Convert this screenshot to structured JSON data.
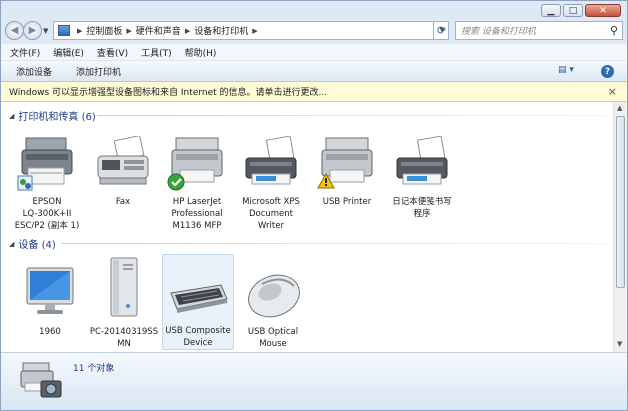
{
  "breadcrumb": [
    "控制面板",
    "硬件和声音",
    "设备和打印机"
  ],
  "search_placeholder": "搜索 设备和打印机",
  "menu": [
    "文件(F)",
    "编辑(E)",
    "查看(V)",
    "工具(T)",
    "帮助(H)"
  ],
  "commands": [
    "添加设备",
    "添加打印机"
  ],
  "infobar_text": "Windows 可以显示增强型设备图标和来自 Internet 的信息。请单击进行更改...",
  "groups": {
    "printers": {
      "title": "打印机和传真 (6)",
      "items": [
        {
          "label": "EPSON\nLQ-300K+II\nESC/P2 (副本 1)",
          "icon": "printer-icon",
          "badge": "shared-badge-icon"
        },
        {
          "label": "Fax",
          "icon": "fax-icon"
        },
        {
          "label": "HP LaserJet\nProfessional\nM1136 MFP",
          "icon": "printer-icon",
          "badge": "default-check-icon"
        },
        {
          "label": "Microsoft XPS\nDocument\nWriter",
          "icon": "printer-icon"
        },
        {
          "label": "USB Printer",
          "icon": "printer-icon",
          "badge": "warning-icon"
        },
        {
          "label": "日记本便笺书写\n程序",
          "icon": "printer-icon"
        }
      ]
    },
    "devices": {
      "title": "设备 (4)",
      "items": [
        {
          "label": "1960",
          "icon": "monitor-icon"
        },
        {
          "label": "PC-20140319SS\nMN",
          "icon": "computer-tower-icon"
        },
        {
          "label": "USB Composite\nDevice",
          "icon": "keyboard-icon",
          "selected": true
        },
        {
          "label": "USB Optical\nMouse",
          "icon": "mouse-icon"
        }
      ]
    }
  },
  "status_text": "11 个对象",
  "colors": {
    "accent": "#1e3a8a",
    "infobar": "#fffbd6",
    "selection": "#e9f2fb"
  }
}
